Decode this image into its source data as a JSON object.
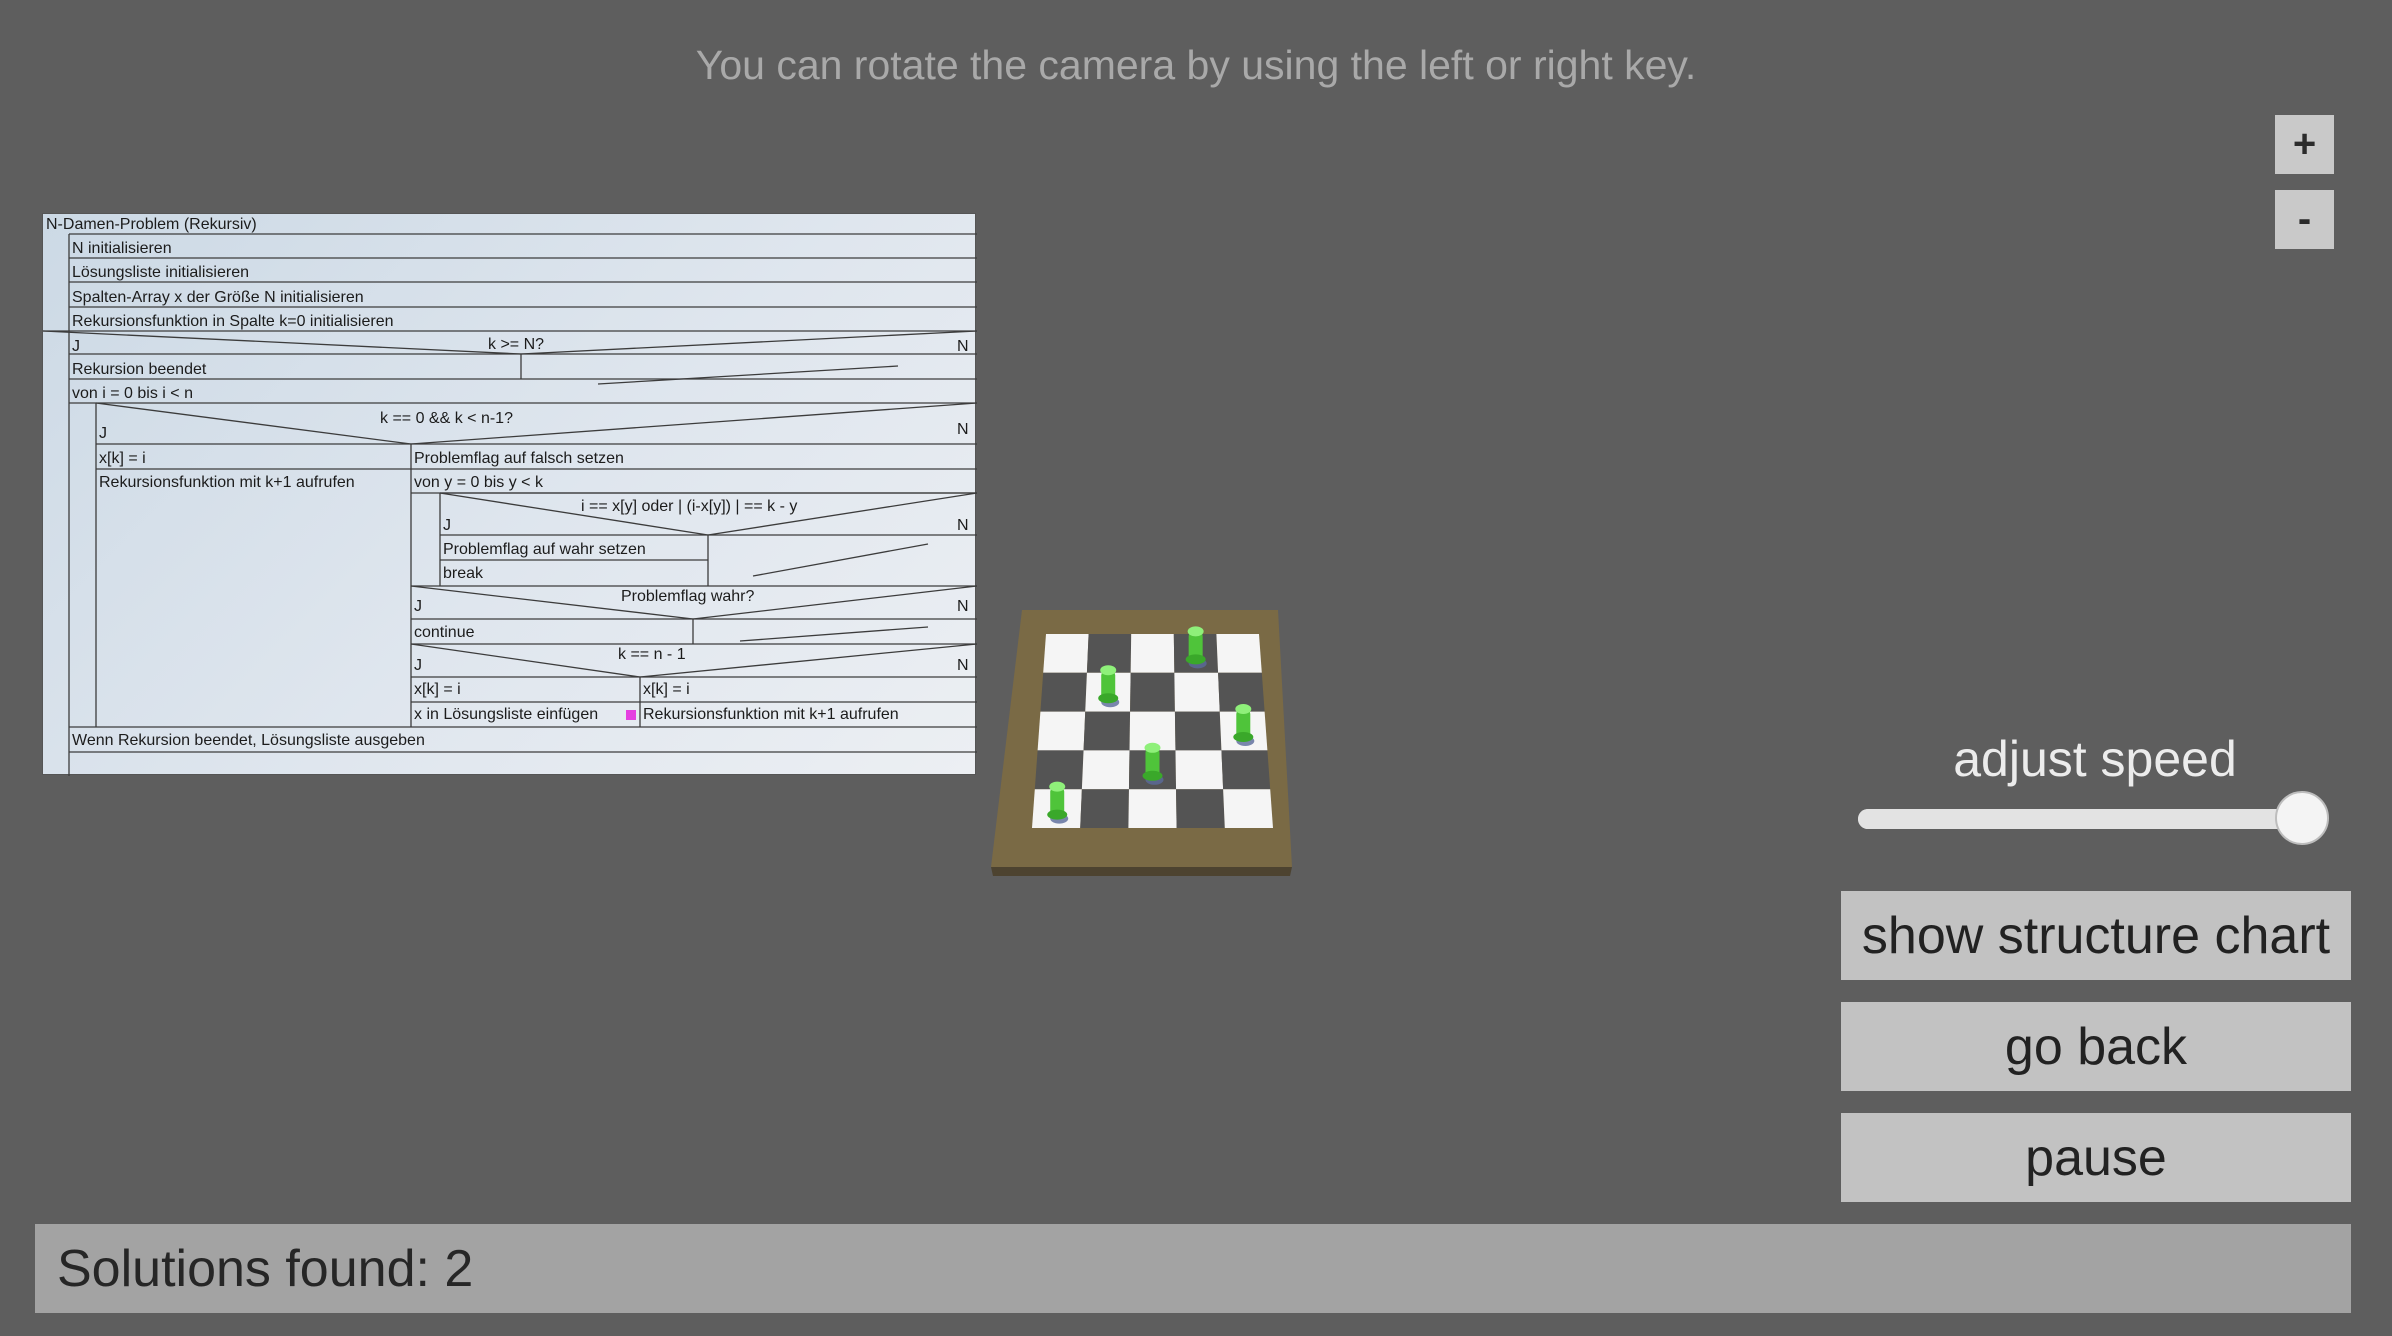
{
  "hint_text": "You can rotate the camera by using the left or right key.",
  "zoom": {
    "in_label": "+",
    "out_label": "-"
  },
  "structure_chart": {
    "title": "N-Damen-Problem (Rekursiv)",
    "init_n": "N initialisieren",
    "init_list": "Lösungsliste initialisieren",
    "init_array": "Spalten-Array x der Größe N initialisieren",
    "init_recursion": "Rekursionsfunktion in Spalte k=0 initialisieren",
    "cond1": "k >= N?",
    "yes": "J",
    "no": "N",
    "recursion_done": "Rekursion beendet",
    "loop1": "von i = 0 bis i < n",
    "cond2": "k == 0 && k < n-1?",
    "assign1": "x[k] = i",
    "call1": "Rekursionsfunktion mit k+1 aufrufen",
    "flag_false": "Problemflag auf falsch setzen",
    "loop2": "von y = 0 bis y < k",
    "cond3": "i == x[y] oder | (i-x[y]) | == k - y",
    "flag_true": "Problemflag auf wahr setzen",
    "break": "break",
    "cond4": "Problemflag wahr?",
    "continue": "continue",
    "cond5": "k == n - 1",
    "assign2": "x[k] = i",
    "assign3": "x[k] = i",
    "insert_list": "x in Lösungsliste einfügen",
    "call2": "Rekursionsfunktion mit k+1 aufrufen",
    "output": "Wenn Rekursion beendet, Lösungsliste ausgeben",
    "highlight_color": "#e53fe0"
  },
  "board": {
    "size": 5,
    "queens": [
      [
        0,
        3
      ],
      [
        1,
        1
      ],
      [
        2,
        4
      ],
      [
        3,
        2
      ],
      [
        4,
        0
      ]
    ],
    "queen_color": "#4fc43a"
  },
  "speed": {
    "label": "adjust speed",
    "value": 1.0
  },
  "buttons": {
    "show_chart": "show structure chart",
    "go_back": "go back",
    "pause": "pause"
  },
  "status": {
    "solutions_text": "Solutions found: 2"
  },
  "colors": {
    "background": "#5e5e5e",
    "button": "#c2c2c2",
    "status_bar": "#a3a3a3"
  }
}
